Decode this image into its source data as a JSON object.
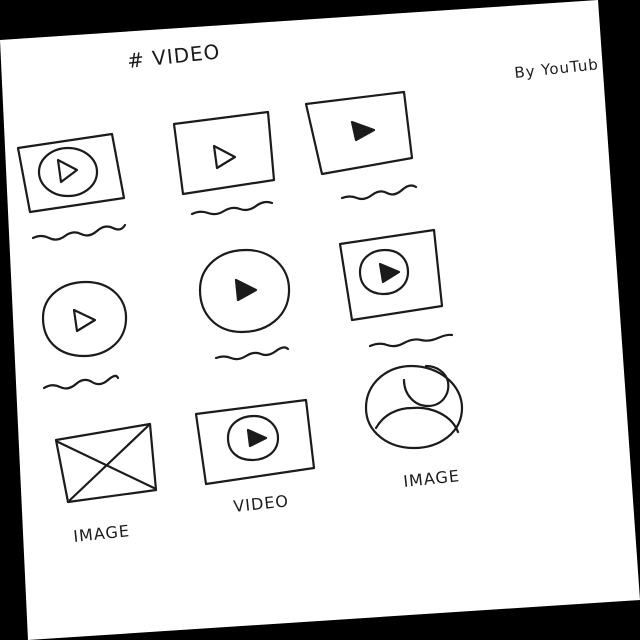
{
  "page": {
    "hashtag": "# VIDEO",
    "byline": "By YouTub"
  },
  "labels": {
    "image_left": "IMAGE",
    "video_bottom": "VIDEO",
    "image_right": "IMAGE"
  },
  "icons": [
    "video-thumbnail-circle-play-outline-icon",
    "video-thumbnail-play-outline-icon",
    "video-thumbnail-play-filled-icon",
    "circle-play-outline-icon",
    "circle-play-filled-icon",
    "video-thumbnail-circle-play-filled-icon",
    "image-placeholder-icon",
    "video-thumbnail-circle-play-filled-icon",
    "user-avatar-icon"
  ],
  "colors": {
    "ink": "#1b1b1b",
    "paper": "#ffffff",
    "background": "#000000"
  }
}
